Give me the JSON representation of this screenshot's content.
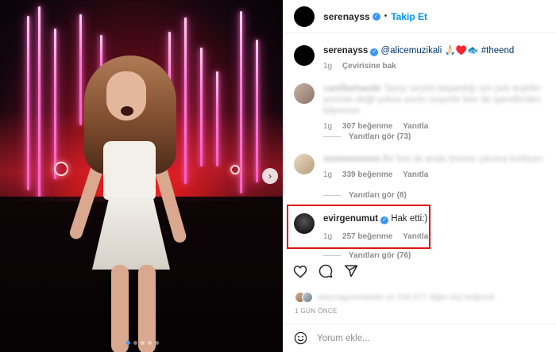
{
  "post": {
    "image_dots": {
      "count": 5,
      "active_index": 0
    },
    "next_icon": "chevron-right-icon"
  },
  "header": {
    "username": "serenayss",
    "separator": "•",
    "follow_label": "Takip Et"
  },
  "caption": {
    "username": "serenayss",
    "mention": "@alicemuzikali",
    "emoji": "🙏🏻♥️🐟",
    "hashtag": "#theend",
    "time": "1g",
    "translate_label": "Çevirisine bak"
  },
  "comments": [
    {
      "username": "canlikehande",
      "text": "Tayıyı seçimi başardığı için pek teşkilin yerinde değil yoksa senin neşenle ben de işaretlerden bilyorsun",
      "time": "1g",
      "likes": "307 beğenme",
      "reply": "Yanıtla",
      "view_replies": "Yanıtları gör (73)"
    },
    {
      "username": "mmmmmmm",
      "text": "Bir foto iki anda önüme çıkınca korktum",
      "time": "1g",
      "likes": "339 beğenme",
      "reply": "Yanıtla",
      "view_replies": "Yanıtları gör (8)"
    },
    {
      "username": "evirgenumut",
      "text": "Hak etti:)",
      "time": "1g",
      "likes": "257 beğenme",
      "reply": "Yanıtla",
      "view_replies": "Yanıtları gör (76)"
    }
  ],
  "actions": {
    "like_icon": "heart-icon",
    "comment_icon": "comment-icon",
    "share_icon": "share-icon"
  },
  "likes_summary": "aleynagunesdede ve 234.677 diğer kişi beğendi",
  "timestamp": "1 GÜN ÖNCE",
  "add_comment": {
    "emoji_icon": "smiley-icon",
    "placeholder": "Yorum ekle..."
  },
  "colors": {
    "accent": "#0095f6",
    "verified": "#3897f0",
    "highlight": "#e01414"
  }
}
